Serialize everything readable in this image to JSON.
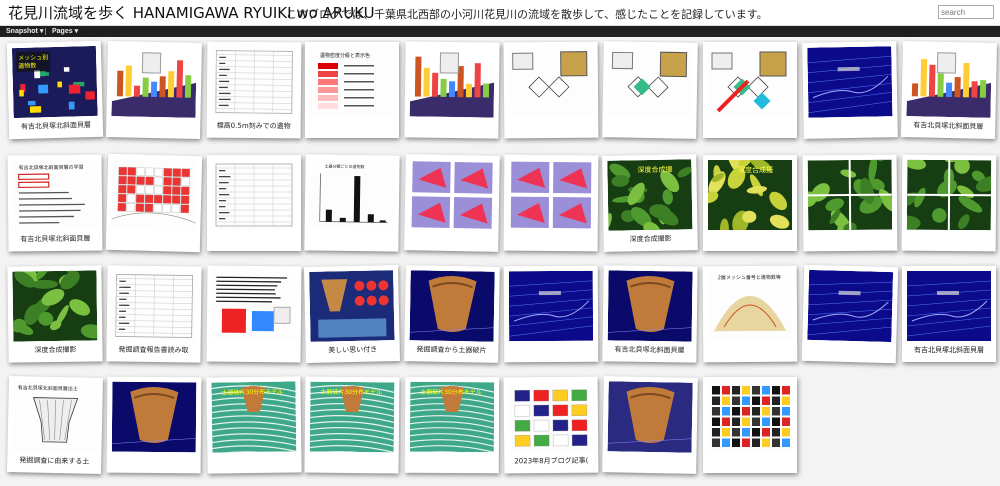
{
  "header": {
    "title": "花見川流域を歩く HANAMIGAWA RYUIKI wo ARUKU",
    "description": "このブログでは、千葉県北西部の小河川花見川の流域を散歩して、感じたことを記録しています。",
    "search_placeholder": "search"
  },
  "nav": {
    "snapshot_label": "Snapshot ▾",
    "pages_label": "Pages ▾"
  },
  "gallery": {
    "row1": [
      {
        "caption": "有吉北貝塚北斜面貝層",
        "thumb": "ramen-map"
      },
      {
        "caption": "",
        "thumb": "3d-blocks"
      },
      {
        "caption": "標高0.5m刻みでの遺物",
        "thumb": "table-doc"
      },
      {
        "caption": "",
        "thumb": "color-legend"
      },
      {
        "caption": "",
        "thumb": "3d-columns"
      },
      {
        "caption": "",
        "thumb": "uv-sketch"
      },
      {
        "caption": "",
        "thumb": "texture-sketch"
      },
      {
        "caption": "",
        "thumb": "texture-sketch-2"
      },
      {
        "caption": "",
        "thumb": "blue-map"
      },
      {
        "caption": "有吉北貝塚北斜面貝層",
        "thumb": "3d-map"
      }
    ],
    "row2": [
      {
        "caption": "有吉北貝塚北斜面貝層",
        "thumb": "doc-diagram"
      },
      {
        "caption": "",
        "thumb": "red-plan"
      },
      {
        "caption": "",
        "thumb": "table-doc-2"
      },
      {
        "caption": "",
        "thumb": "bar-chart"
      },
      {
        "caption": "",
        "thumb": "purple-map"
      },
      {
        "caption": "",
        "thumb": "purple-map-2"
      },
      {
        "caption": "深度合成撮影",
        "thumb": "leaves"
      },
      {
        "caption": "",
        "thumb": "yellow-leaves"
      },
      {
        "caption": "",
        "thumb": "leaves-grid"
      },
      {
        "caption": "",
        "thumb": "leaves-grid-2"
      }
    ],
    "row3": [
      {
        "caption": "深度合成撮影",
        "thumb": "leaf"
      },
      {
        "caption": "発掘調査報告書読み取",
        "thumb": "table-doc-3"
      },
      {
        "caption": "",
        "thumb": "cubes-text"
      },
      {
        "caption": "美しい思い付き",
        "thumb": "pottery-collage"
      },
      {
        "caption": "発掘調査から土器破片",
        "thumb": "pottery"
      },
      {
        "caption": "",
        "thumb": "blue-space"
      },
      {
        "caption": "有吉北貝塚北斜面貝層",
        "thumb": "pottery-2"
      },
      {
        "caption": "",
        "thumb": "fan-map"
      },
      {
        "caption": "",
        "thumb": "blue-space-2"
      },
      {
        "caption": "有吉北貝塚北斜面貝層",
        "thumb": "blue-space-3"
      }
    ],
    "row4": [
      {
        "caption": "発掘調査に由来する土",
        "thumb": "pottery-drawing"
      },
      {
        "caption": "",
        "thumb": "pottery-3"
      },
      {
        "caption": "",
        "thumb": "terrain"
      },
      {
        "caption": "",
        "thumb": "terrain-2"
      },
      {
        "caption": "",
        "thumb": "terrain-3"
      },
      {
        "caption": "2023年8月ブログ記事(",
        "thumb": "collage"
      },
      {
        "caption": "",
        "thumb": "yellow-pottery"
      },
      {
        "caption": "",
        "thumb": "dark-collage"
      }
    ]
  }
}
